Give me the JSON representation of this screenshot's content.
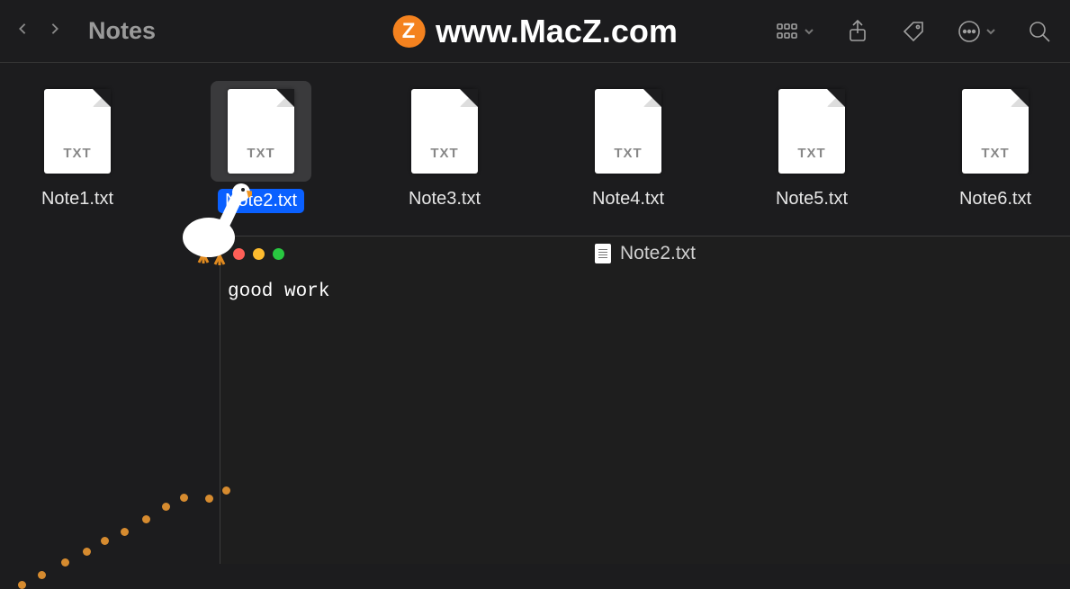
{
  "toolbar": {
    "folder_title": "Notes",
    "watermark": "www.MacZ.com",
    "watermark_badge": "Z"
  },
  "files": [
    {
      "name": "Note1.txt",
      "ext": "TXT",
      "selected": false
    },
    {
      "name": "Note2.txt",
      "ext": "TXT",
      "selected": true
    },
    {
      "name": "Note3.txt",
      "ext": "TXT",
      "selected": false
    },
    {
      "name": "Note4.txt",
      "ext": "TXT",
      "selected": false
    },
    {
      "name": "Note5.txt",
      "ext": "TXT",
      "selected": false
    },
    {
      "name": "Note6.txt",
      "ext": "TXT",
      "selected": false
    }
  ],
  "preview": {
    "title": "Note2.txt",
    "content": "good work"
  },
  "goose": {
    "present": true
  }
}
